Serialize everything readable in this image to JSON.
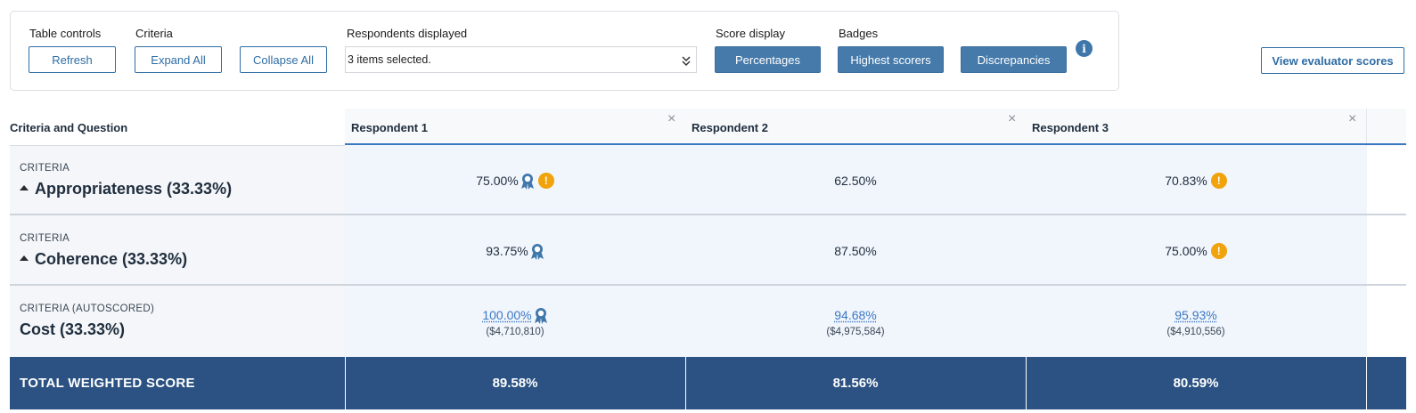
{
  "controls": {
    "table_controls_label": "Table controls",
    "refresh_label": "Refresh",
    "criteria_label": "Criteria",
    "expand_all_label": "Expand All",
    "collapse_all_label": "Collapse All",
    "respondents_label": "Respondents displayed",
    "respondents_value": "3 items selected.",
    "score_display_label": "Score display",
    "percentages_label": "Percentages",
    "badges_label": "Badges",
    "highest_scorers_label": "Highest scorers",
    "discrepancies_label": "Discrepancies",
    "view_evaluator_label": "View evaluator scores"
  },
  "table": {
    "header_left": "Criteria and Question",
    "respondents": [
      "Respondent 1",
      "Respondent 2",
      "Respondent 3"
    ],
    "rows": [
      {
        "type_label": "CRITERIA",
        "name": "Appropriateness (33.33%)",
        "scores": [
          "75.00%",
          "62.50%",
          "70.83%"
        ],
        "badges": [
          [
            "ribbon",
            "warning"
          ],
          [],
          [
            "warning"
          ]
        ]
      },
      {
        "type_label": "CRITERIA",
        "name": "Coherence (33.33%)",
        "scores": [
          "93.75%",
          "87.50%",
          "75.00%"
        ],
        "badges": [
          [
            "ribbon"
          ],
          [],
          [
            "warning"
          ]
        ]
      },
      {
        "type_label": "CRITERIA (AUTOSCORED)",
        "name": "Cost (33.33%)",
        "scores": [
          "100.00%",
          "94.68%",
          "95.93%"
        ],
        "costs": [
          "($4,710,810)",
          "($4,975,584)",
          "($4,910,556)"
        ],
        "badges": [
          [
            "ribbon"
          ],
          [],
          []
        ]
      }
    ],
    "total_label": "TOTAL WEIGHTED SCORE",
    "totals": [
      "89.58%",
      "81.56%",
      "80.59%"
    ]
  },
  "colors": {
    "accent": "#3a78c3",
    "button_fill": "#457aaa",
    "total_bg": "#2b5282",
    "warning": "#f0a30a",
    "ribbon": "#3f77ab"
  },
  "icons": {
    "close": "close-icon",
    "ribbon": "ribbon-icon",
    "warning": "warning-icon",
    "info": "info-icon",
    "chevron": "double-chevron-down-icon",
    "caret": "caret-up-icon"
  },
  "glyphs": {
    "close": "×",
    "warning": "!",
    "info": "i"
  }
}
